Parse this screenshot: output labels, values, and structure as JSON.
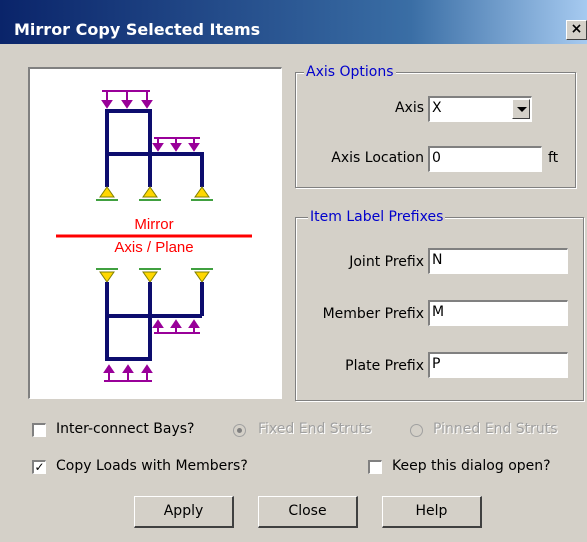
{
  "window": {
    "title": "Mirror Copy Selected Items",
    "close_glyph": "×"
  },
  "preview": {
    "mirror_label": "Mirror",
    "axis_plane_label": "Axis / Plane",
    "colors": {
      "frame": "#0d0d6e",
      "load": "#990099",
      "mirror": "#ff0000",
      "support": "#ffd700"
    }
  },
  "axis_options": {
    "legend": "Axis Options",
    "axis_label": "Axis",
    "axis_value": "X",
    "axis_location_label": "Axis Location",
    "axis_location_value": "0",
    "axis_location_unit": "ft"
  },
  "prefixes": {
    "legend": "Item Label Prefixes",
    "joint_label": "Joint Prefix",
    "joint_value": "N",
    "member_label": "Member Prefix",
    "member_value": "M",
    "plate_label": "Plate Prefix",
    "plate_value": "P"
  },
  "options": {
    "interconnect_label": "Inter-connect Bays?",
    "interconnect_checked": false,
    "fixed_end_label": "Fixed End Struts",
    "pinned_end_label": "Pinned End Struts",
    "copy_loads_label": "Copy Loads with Members?",
    "copy_loads_checked": true,
    "keep_open_label": "Keep this dialog open?",
    "keep_open_checked": false
  },
  "buttons": {
    "apply": "Apply",
    "close": "Close",
    "help": "Help"
  }
}
